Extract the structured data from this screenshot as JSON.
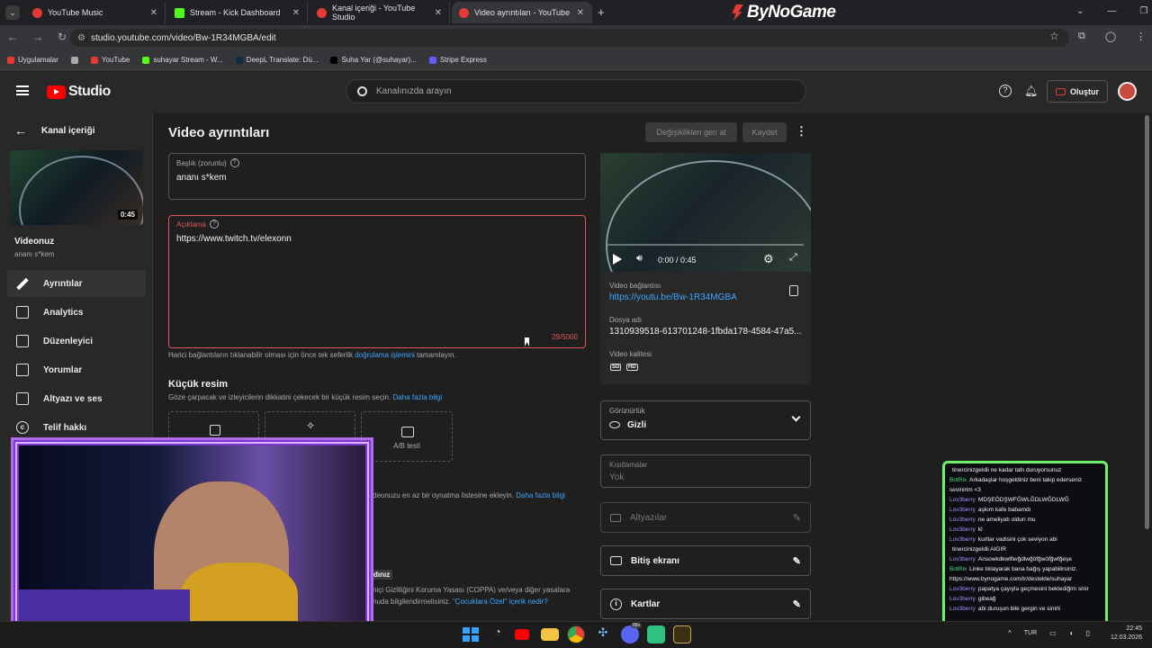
{
  "browser": {
    "tabs": [
      {
        "label": "YouTube Music"
      },
      {
        "label": "Stream - Kick Dashboard"
      },
      {
        "label": "Kanal içeriği - YouTube Studio"
      },
      {
        "label": "Video ayrıntıları - YouTube Studio"
      }
    ],
    "brand": "ByNoGame",
    "url": "studio.youtube.com/video/Bw-1R34MGBA/edit",
    "bookmarks": [
      "Uygulamalar",
      "YouTube",
      "suhayar Stream - W...",
      "DeepL Translate: Dü...",
      "Suha Yar (@suhayar)...",
      "Stripe Express"
    ]
  },
  "header": {
    "logo": "Studio",
    "search_placeholder": "Kanalınızda arayın",
    "create_label": "Oluştur"
  },
  "sidebar": {
    "back_label": "Kanal içeriği",
    "duration": "0:45",
    "video_heading": "Videonuz",
    "video_title": "ananı s*kem",
    "items": [
      {
        "label": "Ayrıntılar"
      },
      {
        "label": "Analytics"
      },
      {
        "label": "Düzenleyici"
      },
      {
        "label": "Yorumlar"
      },
      {
        "label": "Altyazı ve ses"
      },
      {
        "label": "Telif hakkı"
      }
    ]
  },
  "main": {
    "page_title": "Video ayrıntıları",
    "undo_label": "Değişiklikleri geri al",
    "save_label": "Kaydet",
    "title_field": {
      "label": "Başlık (zorunlu)",
      "value": "ananı s*kem"
    },
    "desc_field": {
      "label": "Açıklama",
      "value": "https://www.twitch.tv/elexonn",
      "counter": "29/5000"
    },
    "desc_note_pre": "Harici bağlantıların tıklanabilir olması için önce tek seferlik",
    "desc_note_link": "doğrulama işlemini",
    "desc_note_post": "tamamlayın.",
    "thumb_heading": "Küçük resim",
    "thumb_desc": "Göze çarpacak ve izleyicilerin dikkatini çekecek bir küçük resim seçin.",
    "thumb_link": "Daha fazla bilgi",
    "ab_label": "A/B testi",
    "playlist_text": "deonuzu en az bir oynatma listesine ekleyin.",
    "playlist_link": "Daha fazla bilgi",
    "audience_fragment": "dınız",
    "coppa_text": "niçi Gizliliğini Koruma Yasası (COPPA) ve/veya diğer yasalara",
    "coppa_text2": "nuda bilgilendirmelisiniz.",
    "coppa_link": "\"Çocuklara Özel\" içerik nedir?"
  },
  "right": {
    "player_time": "0:00 / 0:45",
    "link_label": "Video bağlantısı",
    "link_value": "https://youtu.be/Bw-1R34MGBA",
    "file_label": "Dosya adı",
    "file_value": "1310939518-613701248-1fbda178-4584-47a5...",
    "quality_label": "Video kalitesi",
    "q_sd": "SD",
    "q_hd": "HD",
    "visibility_label": "Görünürlük",
    "visibility_value": "Gizli",
    "restrictions_label": "Kısıtlamalar",
    "restrictions_value": "Yok",
    "subtitles_label": "Altyazılar",
    "endscreen_label": "Bitiş ekranı",
    "cards_label": "Kartlar"
  },
  "chat": [
    {
      "name": "",
      "text": "tinercinizgeldii ne kadar tatlı duruyorsunuz"
    },
    {
      "name": "BotRix",
      "text": "Arkadaşlar hoşgeldiniz beni takip ederseniz sevinirim <3",
      "bot": true
    },
    {
      "name": "Lov3berry",
      "text": "MDŞEÖDŞWFĞWLĞDLWĞDLWĞ"
    },
    {
      "name": "Lov3berry",
      "text": "aşkım kafe babamdı"
    },
    {
      "name": "Lov3berry",
      "text": "ne ameliyatı oldun mu"
    },
    {
      "name": "Lov3berry",
      "text": "kl"
    },
    {
      "name": "Lov3berry",
      "text": "kurtlar vadisini çok seviyon abi"
    },
    {
      "name": "",
      "text": "tinercinizgeldii AIGIR"
    },
    {
      "name": "Lov3berry",
      "text": "Ansowkdkwlfiwğdlwğöfğwöfğwfğeşe"
    },
    {
      "name": "BotRix",
      "text": "Linke tıklayarak bana bağış yapabilirsiniz. https://www.bynogame.com/tr/destekle/suhayar",
      "bot": true
    },
    {
      "name": "Lov3berry",
      "text": "papatya çayıyla geçmesini beklediğim sinir"
    },
    {
      "name": "Lov3berry",
      "text": "gibeağ"
    },
    {
      "name": "Lov3berry",
      "text": "abi duruşun bile gergin ve sinirli"
    }
  ],
  "taskbar": {
    "lang": "TUR",
    "time": "22:45",
    "date": "12.03.2026",
    "badge": "99+"
  }
}
